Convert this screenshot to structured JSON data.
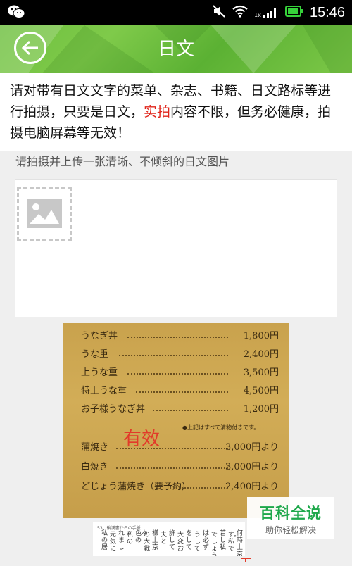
{
  "status_bar": {
    "time": "15:46",
    "network": "1x"
  },
  "app_bar": {
    "title": "日文"
  },
  "notice": {
    "text_before": "请对带有日文文字的菜单、杂志、书籍、日文路标等进行拍摄，只要是日文，",
    "highlight": "实拍",
    "text_after": "内容不限，但务必健康，拍摄电脑屏幕等无效！"
  },
  "upload": {
    "label": "请拍摄并上传一张清晰、不倾斜的日文图片"
  },
  "sample_valid": {
    "stamp": "有效",
    "menu": [
      {
        "item": "うなぎ丼",
        "price": "1,800円"
      },
      {
        "item": "うな重",
        "price": "2,400円"
      },
      {
        "item": "上うな重",
        "price": "3,500円"
      },
      {
        "item": "特上うな重",
        "price": "4,500円"
      },
      {
        "item": "お子様うなぎ丼",
        "price": "1,200円"
      },
      {
        "item": "蒲焼き",
        "price": "3,000円より"
      },
      {
        "item": "白焼き",
        "price": "3,000円より"
      },
      {
        "item": "どじょう蒲焼き（要予約）",
        "price": "2,400円より"
      }
    ],
    "note": "●上記はすべて清物付きです。"
  },
  "sample_book": {
    "header": "53　後漢書からの手紙",
    "columns": [
      "何時上京",
      "す。私で",
      "若し私",
      "でしょう",
      "は必ず",
      "うして",
      "をして",
      "大変お",
      "許して",
      "夫と",
      "様上京",
      "の大戦",
      "色々の",
      "私の",
      "れまし",
      "元気に",
      "私の居"
    ]
  },
  "watermark": {
    "main": "百科全说",
    "sub": "助你轻松解决"
  }
}
